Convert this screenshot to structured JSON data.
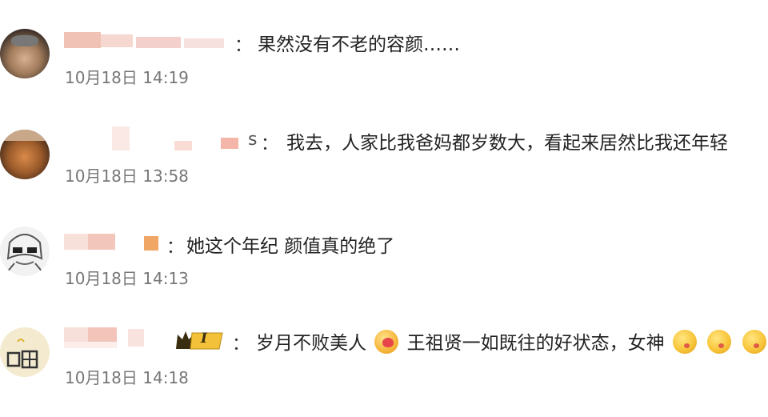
{
  "comments": [
    {
      "name_suffix": "",
      "text": "果然没有不老的容颜……",
      "time": "10月18日 14:19"
    },
    {
      "name_suffix": "s",
      "text": "我去，人家比我爸妈都岁数大，看起来居然比我还年轻",
      "time": "10月18日 13:58"
    },
    {
      "name_suffix": "",
      "text": "她这个年纪 颜值真的绝了",
      "time": "10月18日 14:13"
    },
    {
      "name_suffix": "",
      "text_part1": "岁月不败美人",
      "text_part2": "王祖贤一如既往的好状态，女神",
      "time": "10月18日 14:18",
      "badge": "I"
    }
  ],
  "colon": "："
}
